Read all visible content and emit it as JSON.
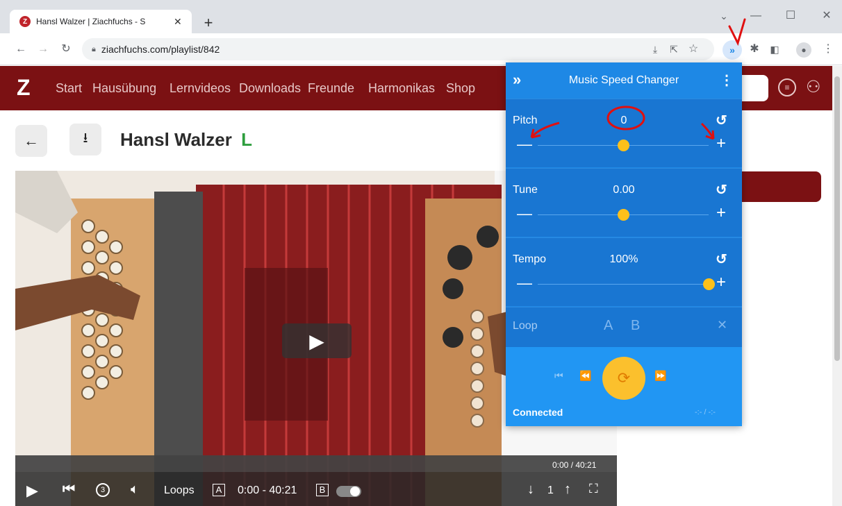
{
  "browser": {
    "tab_title": "Hansl Walzer | Ziachfuchs - S",
    "favicon_letter": "Z",
    "url": "ziachfuchs.com/playlist/842"
  },
  "site": {
    "nav": [
      "Start",
      "Hausübung",
      "Lernvideos",
      "Downloads",
      "Freunde",
      "Harmonikas",
      "Shop"
    ],
    "title": "Hansl Walzer",
    "level": "L"
  },
  "player": {
    "time": "0:00 / 40:21",
    "loops_label": "Loops",
    "a_marker": "A",
    "range": "0:00 - 40:21",
    "b_marker": "B",
    "speed_value": "1",
    "replay_icon_text": "3"
  },
  "popup": {
    "title": "Music Speed Changer",
    "pitch": {
      "label": "Pitch",
      "value": "0",
      "level": 0.5
    },
    "tune": {
      "label": "Tune",
      "value": "0.00",
      "level": 0.5
    },
    "tempo": {
      "label": "Tempo",
      "value": "100%",
      "level": 1.0
    },
    "loop": {
      "label": "Loop",
      "a": "A",
      "b": "B"
    },
    "status": "Connected",
    "time_readout": "-:- / -:-"
  },
  "colors": {
    "site_nav": "#7b1113",
    "popup_bg": "#1e88e5",
    "popup_section": "#1976d2",
    "slider_thumb": "#fdc01a",
    "annotation": "#e01010",
    "level_green": "#2e9e3e"
  }
}
